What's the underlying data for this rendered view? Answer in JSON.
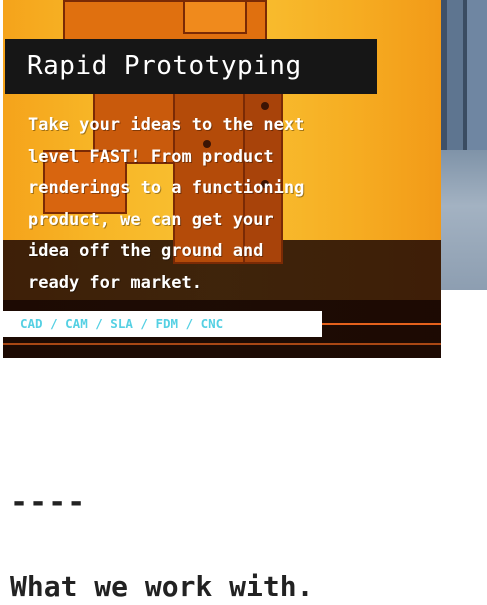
{
  "card": {
    "title": "Rapid Prototyping",
    "description_lines": [
      "Take your ideas to the next",
      "level FAST! From product",
      "renderings to a functioning",
      "product, we can get your",
      "idea off the ground and",
      "ready for market."
    ],
    "tags": "CAD / CAM / SLA / FDM / CNC"
  },
  "divider": "----",
  "section": {
    "heading": "What we work with."
  },
  "colors": {
    "title_bg": "#161616",
    "tag_text": "#55d0e3",
    "card_accent": "#f6b71e"
  }
}
